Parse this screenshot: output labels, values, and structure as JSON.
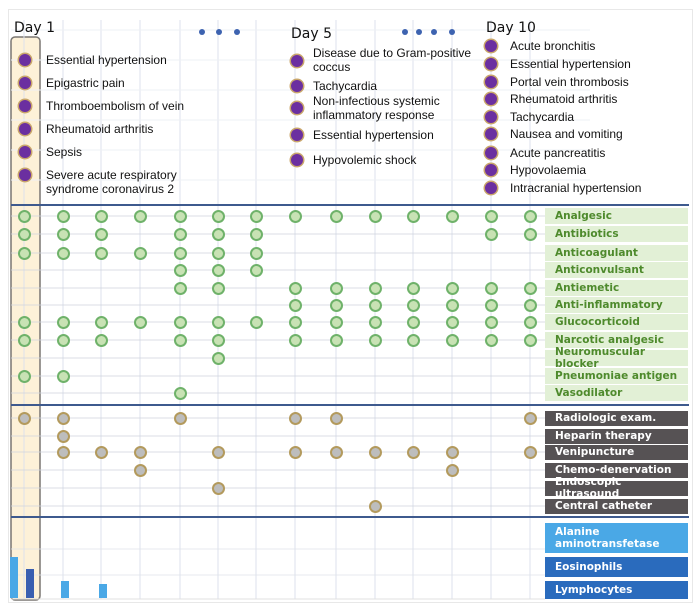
{
  "columns": [
    "Day 1",
    "",
    "",
    "",
    "",
    "",
    "",
    "Day 5",
    "",
    "",
    "",
    "",
    "Day 10",
    ""
  ],
  "day_labels": [
    {
      "label": "Day 1",
      "column": 0
    },
    {
      "label": "Day 5",
      "column": 7
    },
    {
      "label": "Day 10",
      "column": 12
    }
  ],
  "ellipses": [
    {
      "count": 3,
      "between": "Day 1 and Day 5"
    },
    {
      "count": 4,
      "between": "Day 5 and Day 10"
    }
  ],
  "diagnoses": {
    "day1": [
      "Essential hypertension",
      "Epigastric pain",
      "Thromboembolism of vein",
      "Rheumatoid arthritis",
      "Sepsis",
      "Severe acute respiratory syndrome coronavirus 2"
    ],
    "day5": [
      "Disease due to Gram-positive coccus",
      "Tachycardia",
      "Non-infectious systemic inflammatory response",
      "Essential hypertension",
      "Hypovolemic shock"
    ],
    "day10": [
      "Acute bronchitis",
      "Essential hypertension",
      "Portal vein thrombosis",
      "Rheumatoid arthritis",
      "Tachycardia",
      "Nausea and vomiting",
      "Acute pancreatitis",
      "Hypovolaemia",
      "Intracranial hypertension"
    ]
  },
  "medications": [
    {
      "label": "Analgesic",
      "columns": [
        0,
        1,
        2,
        3,
        4,
        5,
        6,
        7,
        8,
        9,
        10,
        11,
        12,
        13
      ]
    },
    {
      "label": "Antibiotics",
      "columns": [
        0,
        1,
        2,
        4,
        5,
        6,
        12,
        13
      ]
    },
    {
      "label": "Anticoagulant",
      "columns": [
        0,
        1,
        2,
        3,
        4,
        5,
        6
      ]
    },
    {
      "label": "Anticonvulsant",
      "columns": [
        4,
        5,
        6
      ]
    },
    {
      "label": "Antiemetic",
      "columns": [
        4,
        5,
        7,
        8,
        9,
        10,
        11,
        12,
        13
      ]
    },
    {
      "label": "Anti-inflammatory",
      "columns": [
        7,
        8,
        9,
        10,
        11,
        12,
        13
      ]
    },
    {
      "label": "Glucocorticoid",
      "columns": [
        0,
        1,
        2,
        3,
        4,
        5,
        6,
        7,
        8,
        9,
        10,
        11,
        12,
        13
      ]
    },
    {
      "label": "Narcotic analgesic",
      "columns": [
        0,
        1,
        2,
        4,
        5,
        7,
        8,
        9,
        10,
        11,
        12,
        13
      ]
    },
    {
      "label": "Neuromuscular blocker",
      "columns": [
        5
      ]
    },
    {
      "label": "Pneumoniae antigen",
      "columns": [
        0,
        1
      ]
    },
    {
      "label": "Vasodilator",
      "columns": [
        4
      ]
    }
  ],
  "procedures": [
    {
      "label": "Radiologic exam.",
      "columns": [
        0,
        1,
        4,
        7,
        8,
        13
      ]
    },
    {
      "label": "Heparin therapy",
      "columns": [
        1
      ]
    },
    {
      "label": "Venipuncture",
      "columns": [
        1,
        2,
        3,
        5,
        7,
        8,
        9,
        10,
        11,
        13
      ]
    },
    {
      "label": "Chemo-denervation",
      "columns": [
        3,
        11
      ]
    },
    {
      "label": "Endoscopic ultrasound",
      "columns": [
        5
      ]
    },
    {
      "label": "Central catheter",
      "columns": [
        9
      ]
    }
  ],
  "labs": [
    {
      "label": "Alanine aminotransfetase",
      "color": "#4aa8e6"
    },
    {
      "label": "Eosinophils",
      "color": "#2a6bbd"
    },
    {
      "label": "Lymphocytes",
      "color": "#2a6bbd"
    }
  ],
  "lab_bars": [
    {
      "column": 0,
      "lab": "Alanine aminotransfetase",
      "relative_level": 0.78,
      "color": "#4aa8e6"
    },
    {
      "column": 0,
      "lab": "Eosinophils",
      "relative_level": 0.56,
      "color": "#3a5fb0"
    },
    {
      "column": 1,
      "lab": "Alanine aminotransfetase",
      "relative_level": 0.32,
      "color": "#4aa8e6"
    },
    {
      "column": 2,
      "lab": "Alanine aminotransfetase",
      "relative_level": 0.27,
      "color": "#4aa8e6"
    }
  ],
  "colors": {
    "diagnosis_dot": "#6b2fa0",
    "medication_fill": "#c8e2b4",
    "medication_stroke": "#6fb26a",
    "procedure_fill": "#bdbdbd",
    "procedure_stroke": "#b39a5d",
    "day1_highlight": "#fdf1d8",
    "section_line": "#3e5a8e",
    "grid_line": "#dde1ec"
  }
}
